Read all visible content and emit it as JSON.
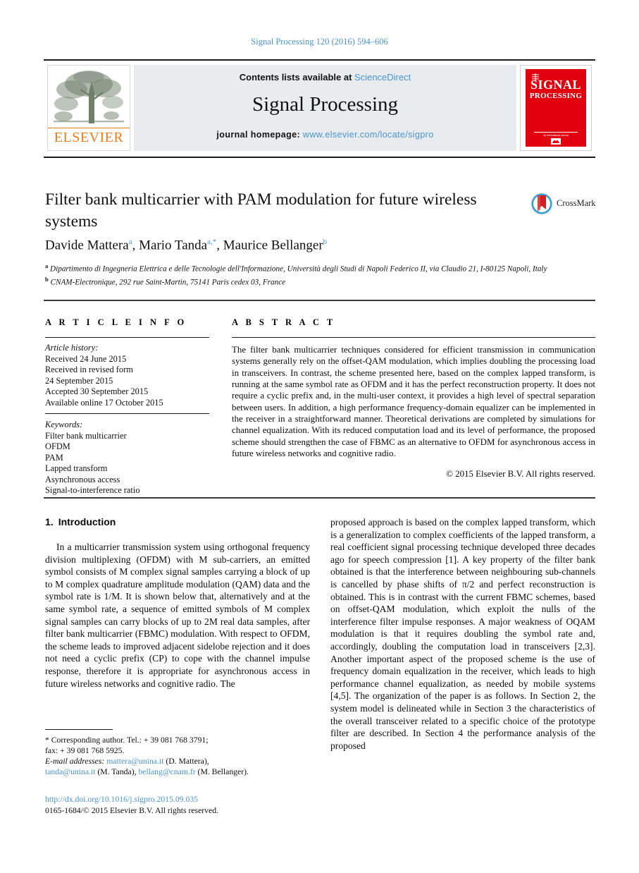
{
  "running_head": "Signal Processing 120 (2016) 594–606",
  "colors": {
    "link_blue": "#4a93d1",
    "elsevier_orange": "#ef7c1b",
    "cover_red": "#e2000f",
    "band_bg": "#e8ecee"
  },
  "masthead": {
    "elsevier_wordmark": "ELSEVIER",
    "contents_prefix": "Contents lists available at ",
    "sciencedirect": "ScienceDirect",
    "journal_title": "Signal Processing",
    "homepage_prefix": "journal homepage: ",
    "homepage_url": "www.elsevier.com/locate/sigpro",
    "cover": {
      "line1": "SIGNAL",
      "line2": "PROCESSING",
      "footer": "An International Journal"
    }
  },
  "article": {
    "title": "Filter bank multicarrier with PAM modulation for future wireless systems",
    "crossmark_label": "CrossMark",
    "authors": [
      {
        "name": "Davide Mattera",
        "marks": "a"
      },
      {
        "name": "Mario Tanda",
        "marks": "a,*"
      },
      {
        "name": "Maurice Bellanger",
        "marks": "b"
      }
    ],
    "authors_separator": ", ",
    "affiliations": [
      {
        "mark": "a",
        "text": "Dipartimento di Ingegneria Elettrica e delle Tecnologie dell'Informazione, Università degli Studi di Napoli Federico II, via Claudio 21, I-80125 Napoli, Italy"
      },
      {
        "mark": "b",
        "text": "CNAM-Electronique, 292 rue Saint-Martin, 75141 Paris cedex 03, France"
      }
    ]
  },
  "article_info": {
    "heading": "A R T I C L E   I N F O",
    "history_label": "Article history:",
    "history": [
      "Received 24 June 2015",
      "Received in revised form",
      "24 September 2015",
      "Accepted 30 September 2015",
      "Available online 17 October 2015"
    ],
    "keywords_label": "Keywords:",
    "keywords": [
      "Filter bank multicarrier",
      "OFDM",
      "PAM",
      "Lapped transform",
      "Asynchronous access",
      "Signal-to-interference ratio"
    ]
  },
  "abstract": {
    "heading": "A B S T R A C T",
    "body": "The filter bank multicarrier techniques considered for efficient transmission in communication systems generally rely on the offset-QAM modulation, which implies doubling the processing load in transceivers. In contrast, the scheme presented here, based on the complex lapped transform, is running at the same symbol rate as OFDM and it has the perfect reconstruction property. It does not require a cyclic prefix and, in the multi-user context, it provides a high level of spectral separation between users. In addition, a high performance frequency-domain equalizer can be implemented in the receiver in a straightforward manner. Theoretical derivations are completed by simulations for channel equalization. With its reduced computation load and its level of performance, the proposed scheme should strengthen the case of FBMC as an alternative to OFDM for asynchronous access in future wireless networks and cognitive radio.",
    "copyright": "© 2015 Elsevier B.V. All rights reserved."
  },
  "body": {
    "section_number": "1.",
    "section_title": "Introduction",
    "left_paragraph_1": "In a multicarrier transmission system using orthogonal frequency division multiplexing (OFDM) with M sub-carriers, an emitted symbol consists of M complex signal samples carrying a block of up to M complex quadrature amplitude modulation (QAM) data and the symbol rate is 1/M. It is shown below that, alternatively and at the same symbol rate, a sequence of emitted symbols of M complex signal samples can carry blocks of up to 2M real data samples, after filter bank multicarrier (FBMC) modulation. With respect to OFDM, the scheme leads to improved adjacent sidelobe rejection and it does not need a cyclic prefix (CP) to cope with the channel impulse response, therefore it is appropriate for asynchronous access in future wireless networks and cognitive radio. The",
    "right_paragraph_1": "proposed approach is based on the complex lapped transform, which is a generalization to complex coefficients of the lapped transform, a real coefficient signal processing technique developed three decades ago for speech compression [1]. A key property of the filter bank obtained is that the interference between neighbouring sub-channels is cancelled by phase shifts of π/2 and perfect reconstruction is obtained. This is in contrast with the current FBMC schemes, based on offset-QAM modulation, which exploit the nulls of the interference filter impulse responses. A major weakness of OQAM modulation is that it requires doubling the symbol rate and, accordingly, doubling the computation load in transceivers [2,3]. Another important aspect of the proposed scheme is the use of frequency domain equalization in the receiver, which leads to high performance channel equalization, as needed by mobile systems [4,5]. The organization of the paper is as follows. In Section 2, the system model is delineated while in Section 3 the characteristics of the overall transceiver related to a specific choice of the prototype filter are described. In Section 4 the performance analysis of the proposed"
  },
  "footnote": {
    "corresponding": "* Corresponding author. Tel.: + 39 081 768 3791;",
    "fax": "fax: + 39 081 768 5925.",
    "email_label": "E-mail addresses:",
    "emails": [
      {
        "address": "mattera@unina.it",
        "owner": "(D. Mattera),"
      },
      {
        "address": "tanda@unina.it",
        "owner": "(M. Tanda),"
      },
      {
        "address": "bellang@cnam.fr",
        "owner": "(M. Bellanger)."
      }
    ]
  },
  "doi_block": {
    "doi": "http://dx.doi.org/10.1016/j.sigpro.2015.09.035",
    "issn": "0165-1684/© 2015 Elsevier B.V. All rights reserved."
  }
}
